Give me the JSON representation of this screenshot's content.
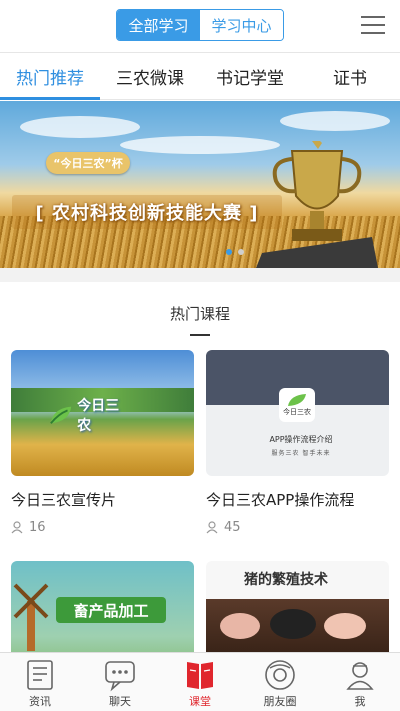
{
  "header": {
    "segments": [
      {
        "label": "全部学习",
        "active": true
      },
      {
        "label": "学习中心",
        "active": false
      }
    ],
    "menu_icon": "hamburger-menu-icon"
  },
  "tabs": [
    {
      "label": "热门推荐",
      "active": true
    },
    {
      "label": "三农微课",
      "active": false
    },
    {
      "label": "书记学堂",
      "active": false
    },
    {
      "label": "证书",
      "active": false
    }
  ],
  "banner": {
    "badge": "“今日三农”杯",
    "title": "[ 农村科技创新技能大赛 ]",
    "slide_count": 2,
    "active_slide": 1
  },
  "section": {
    "title": "热门课程"
  },
  "courses": [
    {
      "title": "今日三农宣传片",
      "views": "16",
      "thumb_text": "今日三农"
    },
    {
      "title": "今日三农APP操作流程",
      "views": "45",
      "thumb_text": "今日三农",
      "thumb_subtitle": "APP操作流程介绍",
      "thumb_tagline": "服务三农  智手未来"
    },
    {
      "title": "",
      "views": "",
      "thumb_text": "畜产品加工"
    },
    {
      "title": "",
      "views": "",
      "thumb_text": "猪的繁殖技术",
      "thumb_highlight": "猪"
    }
  ],
  "bottom_nav": [
    {
      "label": "资讯",
      "icon": "newspaper-icon",
      "active": false
    },
    {
      "label": "聊天",
      "icon": "chat-bubble-icon",
      "active": false
    },
    {
      "label": "课堂",
      "icon": "book-icon",
      "active": true
    },
    {
      "label": "朋友圈",
      "icon": "camera-circle-icon",
      "active": false
    },
    {
      "label": "我",
      "icon": "user-profile-icon",
      "active": false
    }
  ],
  "colors": {
    "accent": "#3a9be6",
    "tab_active": "#2f8fe0",
    "nav_active": "#e0262d"
  }
}
